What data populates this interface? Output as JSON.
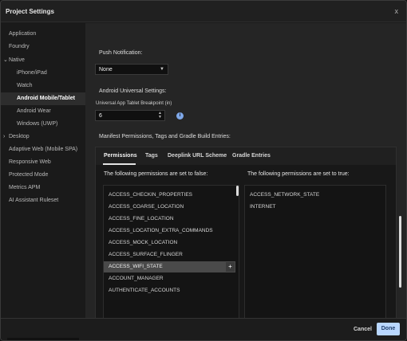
{
  "window": {
    "title": "Project Settings",
    "close_glyph": "x"
  },
  "sidebar": {
    "items": [
      {
        "label": "Application",
        "active": false,
        "has_arrow": false
      },
      {
        "label": "Foundry",
        "active": false,
        "has_arrow": false
      },
      {
        "label": "Native",
        "active": false,
        "has_arrow": true,
        "arrow_glyph": "⌄"
      },
      {
        "label": "iPhone/iPad",
        "active": false,
        "has_arrow": false
      },
      {
        "label": "Watch",
        "active": false,
        "has_arrow": false
      },
      {
        "label": "Android Mobile/Tablet",
        "active": true,
        "has_arrow": false
      },
      {
        "label": "Android Wear",
        "active": false,
        "has_arrow": false
      },
      {
        "label": "Windows (UWP)",
        "active": false,
        "has_arrow": false
      },
      {
        "label": "Desktop",
        "active": false,
        "has_arrow": true,
        "arrow_glyph": "›"
      },
      {
        "label": "Adaptive Web (Mobile SPA)",
        "active": false,
        "has_arrow": false
      },
      {
        "label": "Responsive Web",
        "active": false,
        "has_arrow": false
      },
      {
        "label": "Protected Mode",
        "active": false,
        "has_arrow": false
      },
      {
        "label": "Metrics APM",
        "active": false,
        "has_arrow": false
      },
      {
        "label": "AI Assistant Ruleset",
        "active": false,
        "has_arrow": false
      }
    ]
  },
  "push_notification": {
    "label": "Push Notification:",
    "selected": "None",
    "arrow": "▼"
  },
  "android_universal": {
    "label": "Android Universal Settings:",
    "field_label": "Universal App Tablet Breakpoint (in)",
    "value": "6",
    "stepper_up": "▲",
    "stepper_down": "▼",
    "info_glyph": "i"
  },
  "manifest": {
    "label": "Manifest Permissions, Tags and Gradle Build Entries:",
    "tabs": [
      {
        "label": "Permissions",
        "active": true
      },
      {
        "label": "Tags",
        "active": false
      },
      {
        "label": "Deeplink URL Scheme",
        "active": false
      },
      {
        "label": "Gradle Entries",
        "active": false
      }
    ],
    "false_heading": "The following permissions are set to false:",
    "true_heading": "The following permissions are set to true:",
    "false_permissions": [
      "ACCESS_CHECKIN_PROPERTIES",
      "ACCESS_COARSE_LOCATION",
      "ACCESS_FINE_LOCATION",
      "ACCESS_LOCATION_EXTRA_COMMANDS",
      "ACCESS_MOCK_LOCATION",
      "ACCESS_SURFACE_FLINGER",
      "ACCESS_WIFI_STATE",
      "ACCOUNT_MANAGER",
      "AUTHENTICATE_ACCOUNTS"
    ],
    "selected_index": 6,
    "add_glyph": "+",
    "true_permissions": [
      "ACCESS_NETWORK_STATE",
      "INTERNET"
    ]
  },
  "footer": {
    "cancel_label": "Cancel",
    "done_label": "Done"
  },
  "colors": {
    "accent": "#b9d7ff",
    "info": "#7ea7e8",
    "selected_row": "#4a4a4a"
  },
  "icons": {
    "close": "close-icon",
    "info": "info-icon",
    "dropdown": "chevron-down-icon",
    "add": "plus-icon"
  }
}
